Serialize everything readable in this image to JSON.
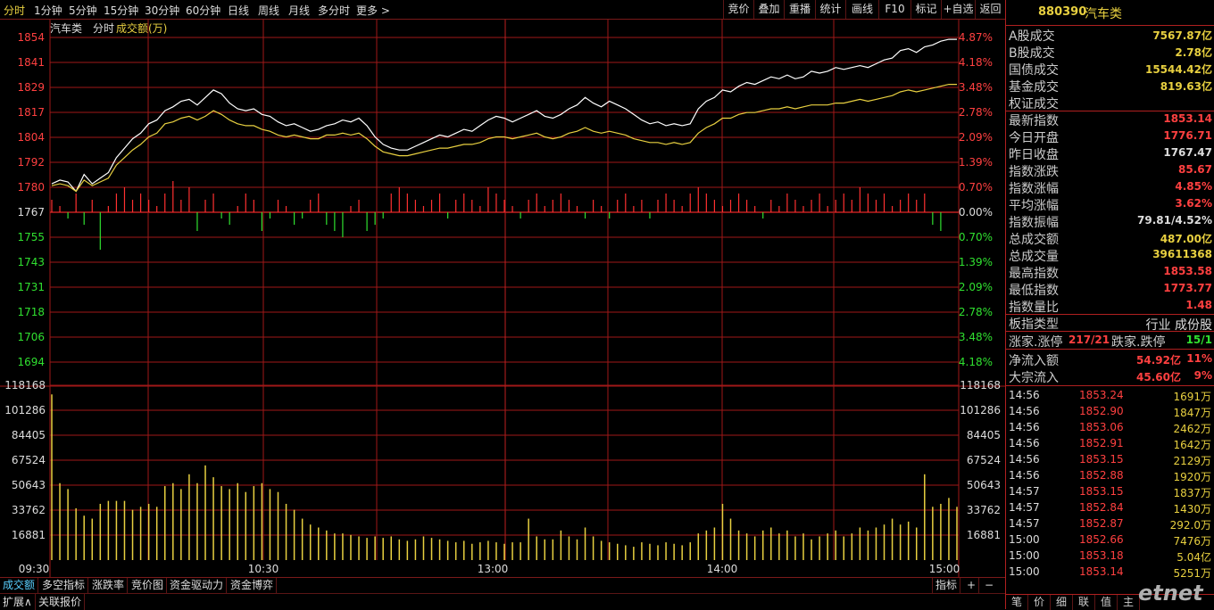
{
  "toolbar": {
    "tabs": [
      "分时",
      "1分钟",
      "5分钟",
      "15分钟",
      "30分钟",
      "60分钟",
      "日线",
      "周线",
      "月线",
      "多分时",
      "更多 >"
    ],
    "right_buttons": [
      "竞价",
      "叠加",
      "重播",
      "统计",
      "画线",
      "F10",
      "标记",
      "+自选",
      "返回"
    ]
  },
  "chart_header": {
    "name": "汽车类",
    "mode": "分时",
    "vol_label": "成交额(万)"
  },
  "price_axis": {
    "left": [
      "1854",
      "1841",
      "1829",
      "1817",
      "1804",
      "1792",
      "1780",
      "1767",
      "1755",
      "1743",
      "1731",
      "1718",
      "1706",
      "1694"
    ],
    "right": [
      "4.87%",
      "4.18%",
      "3.48%",
      "2.78%",
      "2.09%",
      "1.39%",
      "0.70%",
      "0.00%",
      "0.70%",
      "1.39%",
      "2.09%",
      "2.78%",
      "3.48%",
      "4.18%"
    ]
  },
  "volume_axis": [
    "118168",
    "101286",
    "84405",
    "67524",
    "50643",
    "33762",
    "16881"
  ],
  "time_axis": [
    "09:30",
    "10:30",
    "13:00",
    "14:00",
    "15:00"
  ],
  "chart_data": {
    "type": "line",
    "prev_close": 1767.47,
    "ylim": [
      1681,
      1854
    ],
    "vol_ylim": [
      0,
      118168
    ],
    "series": [
      {
        "name": "汽车类",
        "color": "#ffffff",
        "values": [
          1776,
          1778,
          1777,
          1772,
          1781,
          1776,
          1779,
          1782,
          1790,
          1795,
          1800,
          1803,
          1808,
          1810,
          1815,
          1817,
          1820,
          1821,
          1818,
          1822,
          1826,
          1824,
          1819,
          1816,
          1815,
          1816,
          1813,
          1812,
          1809,
          1807,
          1808,
          1806,
          1804,
          1805,
          1807,
          1808,
          1810,
          1809,
          1811,
          1807,
          1801,
          1797,
          1795,
          1794,
          1794,
          1796,
          1798,
          1800,
          1802,
          1801,
          1803,
          1805,
          1804,
          1807,
          1810,
          1812,
          1811,
          1809,
          1811,
          1813,
          1815,
          1812,
          1811,
          1813,
          1816,
          1818,
          1822,
          1819,
          1817,
          1820,
          1818,
          1816,
          1813,
          1810,
          1808,
          1809,
          1807,
          1808,
          1807,
          1808,
          1816,
          1820,
          1822,
          1826,
          1825,
          1828,
          1830,
          1829,
          1831,
          1833,
          1832,
          1834,
          1832,
          1833,
          1836,
          1835,
          1836,
          1838,
          1837,
          1838,
          1839,
          1838,
          1840,
          1842,
          1843,
          1847,
          1848,
          1846,
          1849,
          1850,
          1852,
          1853,
          1853
        ]
      },
      {
        "name": "平均",
        "color": "#e8d040",
        "values": [
          1775,
          1776,
          1775,
          1772,
          1778,
          1775,
          1777,
          1779,
          1786,
          1790,
          1794,
          1797,
          1801,
          1803,
          1808,
          1809,
          1811,
          1812,
          1810,
          1812,
          1815,
          1813,
          1810,
          1808,
          1807,
          1807,
          1805,
          1804,
          1802,
          1801,
          1802,
          1801,
          1800,
          1800,
          1802,
          1802,
          1803,
          1802,
          1803,
          1800,
          1796,
          1793,
          1792,
          1791,
          1791,
          1792,
          1793,
          1794,
          1795,
          1795,
          1796,
          1797,
          1797,
          1798,
          1800,
          1801,
          1801,
          1800,
          1801,
          1802,
          1803,
          1801,
          1800,
          1801,
          1803,
          1804,
          1806,
          1804,
          1803,
          1804,
          1803,
          1802,
          1800,
          1799,
          1798,
          1798,
          1797,
          1798,
          1797,
          1798,
          1803,
          1806,
          1808,
          1811,
          1811,
          1813,
          1814,
          1814,
          1815,
          1816,
          1816,
          1817,
          1816,
          1817,
          1818,
          1818,
          1818,
          1819,
          1819,
          1820,
          1821,
          1820,
          1821,
          1822,
          1823,
          1825,
          1826,
          1825,
          1826,
          1827,
          1828,
          1829,
          1829
        ]
      }
    ],
    "diff_bars": [
      2,
      1,
      -1,
      3,
      -2,
      2,
      -6,
      1,
      3,
      4,
      2,
      3,
      2,
      1,
      3,
      5,
      2,
      4,
      -3,
      2,
      3,
      -1,
      -2,
      1,
      3,
      2,
      -3,
      -1,
      2,
      1,
      -2,
      -1,
      2,
      3,
      -2,
      -3,
      -4,
      1,
      2,
      -3,
      -2,
      -1,
      3,
      4,
      3,
      2,
      1,
      2,
      3,
      -1,
      2,
      3,
      2,
      1,
      4,
      3,
      2,
      1,
      -1,
      2,
      3,
      1,
      2,
      3,
      2,
      1,
      -1,
      2,
      1,
      -1,
      2,
      3,
      1,
      2,
      -1,
      2,
      3,
      2,
      1,
      3,
      4,
      3,
      2,
      1,
      2,
      3,
      2,
      1,
      -1,
      2,
      1,
      3,
      2,
      1,
      2,
      3,
      1,
      2,
      3,
      2,
      4,
      3,
      2,
      3,
      1,
      2,
      3,
      2,
      3,
      -2,
      -3
    ],
    "volumes": [
      112000,
      52000,
      48000,
      35000,
      30000,
      28000,
      38000,
      40000,
      40000,
      40000,
      34000,
      36000,
      38000,
      36000,
      50000,
      52000,
      48000,
      58000,
      52000,
      64000,
      56000,
      50000,
      48000,
      52000,
      46000,
      50000,
      52000,
      48000,
      46000,
      38000,
      34000,
      28000,
      24000,
      22000,
      20000,
      18000,
      18000,
      17000,
      16000,
      15000,
      16000,
      15000,
      16000,
      14000,
      13000,
      14000,
      16000,
      15000,
      14000,
      13000,
      12000,
      13000,
      11000,
      12000,
      13000,
      12000,
      11000,
      12000,
      12000,
      28000,
      16000,
      14000,
      14000,
      20000,
      16000,
      14000,
      22000,
      16000,
      13000,
      12000,
      11000,
      10000,
      9000,
      12000,
      11000,
      10000,
      12000,
      11000,
      10000,
      12000,
      18000,
      20000,
      22000,
      38000,
      28000,
      20000,
      18000,
      16000,
      20000,
      22000,
      18000,
      20000,
      16000,
      18000,
      14000,
      16000,
      18000,
      20000,
      16000,
      18000,
      22000,
      20000,
      22000,
      24000,
      28000,
      24000,
      26000,
      22000,
      58000,
      36000,
      38000,
      42000,
      36000
    ]
  },
  "info": {
    "code": "880390",
    "name": "汽车类",
    "turnover_rows": [
      {
        "k": "A股成交",
        "v": "7567.87亿",
        "c": "#e8d040"
      },
      {
        "k": "B股成交",
        "v": "2.78亿",
        "c": "#e8d040"
      },
      {
        "k": "国债成交",
        "v": "15544.42亿",
        "c": "#e8d040"
      },
      {
        "k": "基金成交",
        "v": "819.63亿",
        "c": "#e8d040"
      },
      {
        "k": "权证成交",
        "v": "",
        "c": "#e8d040"
      }
    ],
    "index_rows": [
      {
        "k": "最新指数",
        "v": "1853.14",
        "c": "#ff4040"
      },
      {
        "k": "今日开盘",
        "v": "1776.71",
        "c": "#ff4040"
      },
      {
        "k": "昨日收盘",
        "v": "1767.47",
        "c": "#dddddd"
      },
      {
        "k": "指数涨跌",
        "v": "85.67",
        "c": "#ff4040"
      },
      {
        "k": "指数涨幅",
        "v": "4.85%",
        "c": "#ff4040"
      },
      {
        "k": "平均涨幅",
        "v": "3.62%",
        "c": "#ff4040"
      },
      {
        "k": "指数振幅",
        "v": "79.81/4.52%",
        "c": "#dddddd"
      },
      {
        "k": "总成交额",
        "v": "487.00亿",
        "c": "#e8d040"
      },
      {
        "k": "总成交量",
        "v": "39611368",
        "c": "#e8d040"
      },
      {
        "k": "最高指数",
        "v": "1853.58",
        "c": "#ff4040"
      },
      {
        "k": "最低指数",
        "v": "1773.77",
        "c": "#ff4040"
      },
      {
        "k": "指数量比",
        "v": "1.48",
        "c": "#ff4040"
      }
    ],
    "type_label": "板指类型",
    "type_value": "行业 成份股",
    "up_label": "涨家.涨停",
    "up_value": "217/21",
    "down_label": "跌家.跌停",
    "down_value": "15/1",
    "flow_rows": [
      {
        "k": "净流入额",
        "v": "54.92亿",
        "p": "11%"
      },
      {
        "k": "大宗流入",
        "v": "45.60亿",
        "p": "9%"
      }
    ],
    "ticks": [
      {
        "t": "14:56",
        "p": "1853.24",
        "v": "1691万"
      },
      {
        "t": "14:56",
        "p": "1852.90",
        "v": "1847万"
      },
      {
        "t": "14:56",
        "p": "1853.06",
        "v": "2462万"
      },
      {
        "t": "14:56",
        "p": "1852.91",
        "v": "1642万"
      },
      {
        "t": "14:56",
        "p": "1853.15",
        "v": "2129万"
      },
      {
        "t": "14:56",
        "p": "1852.88",
        "v": "1920万"
      },
      {
        "t": "14:57",
        "p": "1853.15",
        "v": "1837万"
      },
      {
        "t": "14:57",
        "p": "1852.84",
        "v": "1430万"
      },
      {
        "t": "14:57",
        "p": "1852.87",
        "v": "292.0万"
      },
      {
        "t": "15:00",
        "p": "1852.66",
        "v": "7476万"
      },
      {
        "t": "15:00",
        "p": "1853.18",
        "v": "5.04亿"
      },
      {
        "t": "15:00",
        "p": "1853.14",
        "v": "5251万"
      }
    ],
    "bottom_tabs": [
      "笔",
      "价",
      "细",
      "联",
      "值",
      "主"
    ]
  },
  "bottombar": {
    "tabs": [
      "成交额",
      "多空指标",
      "涨跌率",
      "竞价图",
      "资金驱动力",
      "资金博弈"
    ],
    "right": [
      "指标",
      "+",
      "−",
      "×"
    ]
  },
  "statusbar": {
    "tabs": [
      "扩展∧",
      "关联报价"
    ]
  },
  "watermark": "etnet"
}
